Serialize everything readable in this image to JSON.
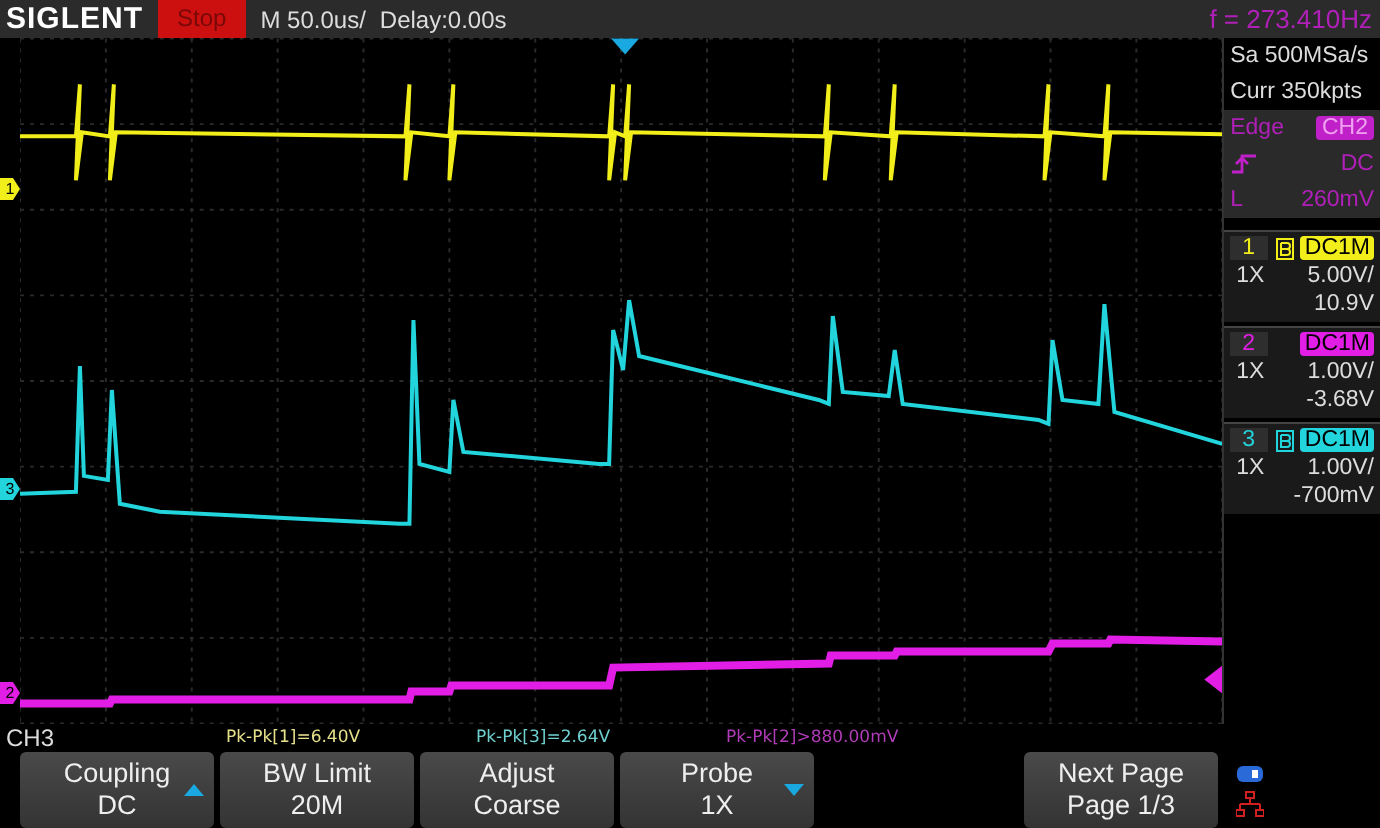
{
  "brand": "SIGLENT",
  "run_state": "Stop",
  "timebase": "M 50.0us/",
  "delay": "Delay:0.00s",
  "frequency": "f = 273.410Hz",
  "acquisition": {
    "sample_rate": "Sa 500MSa/s",
    "memory": "Curr 350kpts"
  },
  "trigger": {
    "type": "Edge",
    "source": "CH2",
    "coupling": "DC",
    "level_label": "L",
    "level": "260mV"
  },
  "traces": [
    {
      "marker": "1",
      "kind": "pulse",
      "color": "#f2ee1a"
    },
    {
      "marker": "3",
      "kind": "spikes",
      "color": "#22d4dc"
    },
    {
      "marker": "2",
      "kind": "staircase",
      "color": "#e21ee6"
    }
  ],
  "channels": [
    {
      "number": "1",
      "color": "#f2ee1a",
      "bw_limit": true,
      "coupling": "DC1M",
      "probe": "1X",
      "scale": "5.00V/",
      "offset": "10.9V"
    },
    {
      "number": "2",
      "color": "#e21ee6",
      "bw_limit": false,
      "coupling": "DC1M",
      "probe": "1X",
      "scale": "1.00V/",
      "offset": "-3.68V"
    },
    {
      "number": "3",
      "color": "#22d4dc",
      "bw_limit": true,
      "coupling": "DC1M",
      "probe": "1X",
      "scale": "1.00V/",
      "offset": "-700mV"
    }
  ],
  "measurements": [
    {
      "text": "Pk-Pk[1]=6.40V",
      "color": "#e6e08a"
    },
    {
      "text": "Pk-Pk[3]=2.64V",
      "color": "#6fd0d0"
    },
    {
      "text": "Pk-Pk[2]>880.00mV",
      "color": "#b03cb8"
    }
  ],
  "menu": {
    "title": "CH3",
    "buttons": [
      {
        "label": "Coupling",
        "value": "DC",
        "kind": "up"
      },
      {
        "label": "BW Limit",
        "value": "20M",
        "kind": "plain"
      },
      {
        "label": "Adjust",
        "value": "Coarse",
        "kind": "plain"
      },
      {
        "label": "Probe",
        "value": "1X",
        "kind": "down"
      },
      {
        "label": "Next Page",
        "value": "Page 1/3",
        "kind": "plain"
      }
    ]
  }
}
